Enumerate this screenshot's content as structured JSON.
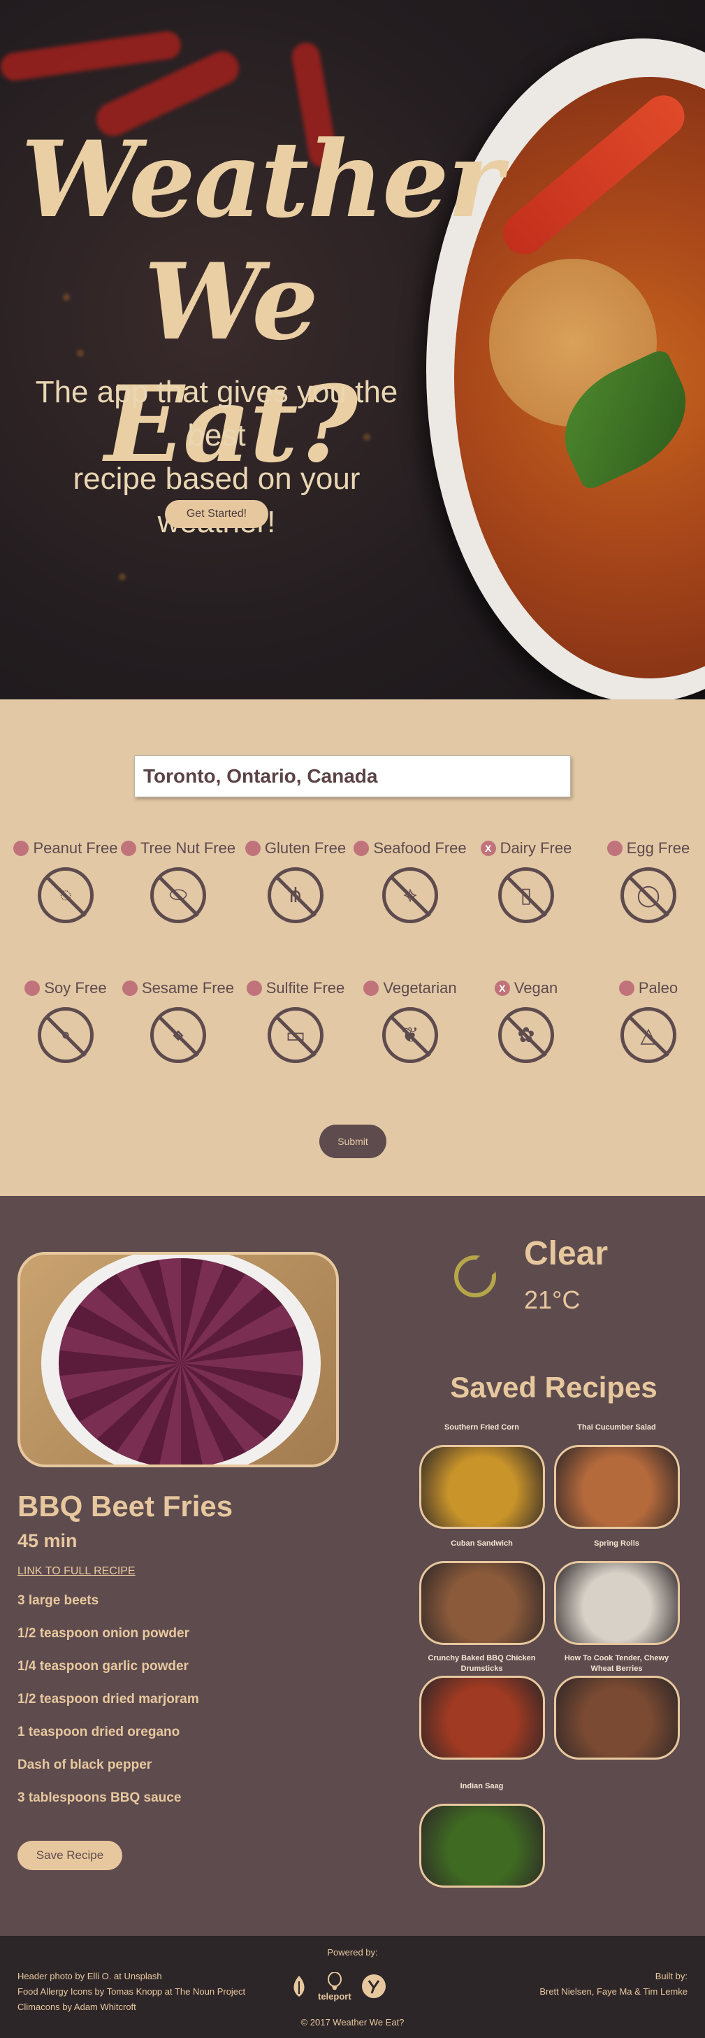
{
  "hero": {
    "title_line1": "Weather",
    "title_line2": "We Eat?",
    "subtitle_line1": "The app that gives you the best",
    "subtitle_line2": "recipe based on your weather!",
    "cta_label": "Get Started!"
  },
  "search": {
    "location_value": "Toronto, Ontario, Canada"
  },
  "filters": {
    "row1": [
      {
        "label": "Peanut Free",
        "icon": "peanut-free-icon",
        "marked": false
      },
      {
        "label": "Tree Nut Free",
        "icon": "tree-nut-free-icon",
        "marked": false
      },
      {
        "label": "Gluten Free",
        "icon": "gluten-free-icon",
        "marked": false
      },
      {
        "label": "Seafood Free",
        "icon": "seafood-free-icon",
        "marked": false
      },
      {
        "label": "Dairy Free",
        "icon": "dairy-free-icon",
        "marked": true,
        "mark": "X"
      },
      {
        "label": "Egg Free",
        "icon": "egg-free-icon",
        "marked": false
      }
    ],
    "row2": [
      {
        "label": "Soy Free",
        "icon": "soy-free-icon",
        "marked": false
      },
      {
        "label": "Sesame Free",
        "icon": "sesame-free-icon",
        "marked": false
      },
      {
        "label": "Sulfite Free",
        "icon": "sulfite-free-icon",
        "marked": false
      },
      {
        "label": "Vegetarian",
        "icon": "vegetarian-icon",
        "marked": false
      },
      {
        "label": "Vegan",
        "icon": "vegan-icon",
        "marked": true,
        "mark": "X"
      },
      {
        "label": "Paleo",
        "icon": "paleo-icon",
        "marked": false
      }
    ],
    "submit_label": "Submit"
  },
  "recipe": {
    "title": "BBQ Beet Fries",
    "time": "45 min",
    "link_label": "LINK TO FULL RECIPE",
    "ingredients": [
      "3 large beets",
      "1/2 teaspoon onion powder",
      "1/4 teaspoon garlic powder",
      "1/2 teaspoon dried marjoram",
      "1 teaspoon dried oregano",
      "Dash of black pepper",
      "3 tablespoons BBQ sauce"
    ],
    "save_label": "Save Recipe"
  },
  "weather": {
    "condition": "Clear",
    "temperature": "21°C",
    "icon": "moon-icon"
  },
  "saved": {
    "title": "Saved Recipes",
    "items": [
      {
        "name": "Southern Fried Corn",
        "color": "#c9942a"
      },
      {
        "name": "Thai Cucumber Salad",
        "color": "#b56a3c"
      },
      {
        "name": "Cuban Sandwich",
        "color": "#8a5a3a"
      },
      {
        "name": "Spring Rolls",
        "color": "#d8d1c8"
      },
      {
        "name": "Crunchy Baked BBQ Chicken Drumsticks",
        "color": "#a13a22"
      },
      {
        "name": "How To Cook Tender, Chewy Wheat Berries",
        "color": "#7a4a32"
      },
      {
        "name": "Indian Saag",
        "color": "#3f6a22"
      }
    ]
  },
  "footer": {
    "credit1": "Header photo by Elli O. at Unsplash",
    "credit2": "Food Allergy Icons by Tomas Knopp at The Noun Project",
    "credit3": "Climacons by Adam Whitcroft",
    "powered_by": "Powered by:",
    "logo_teleport": "teleport",
    "built_by_label": "Built by:",
    "built_by_names": "Brett Nielsen, Faye Ma & Tim Lemke",
    "copyright": "© 2017 Weather We Eat?"
  },
  "colors": {
    "accent": "#e7c89e",
    "brown": "#5e4b4e",
    "tan": "#e2c8a5",
    "mark": "#c0737a"
  }
}
